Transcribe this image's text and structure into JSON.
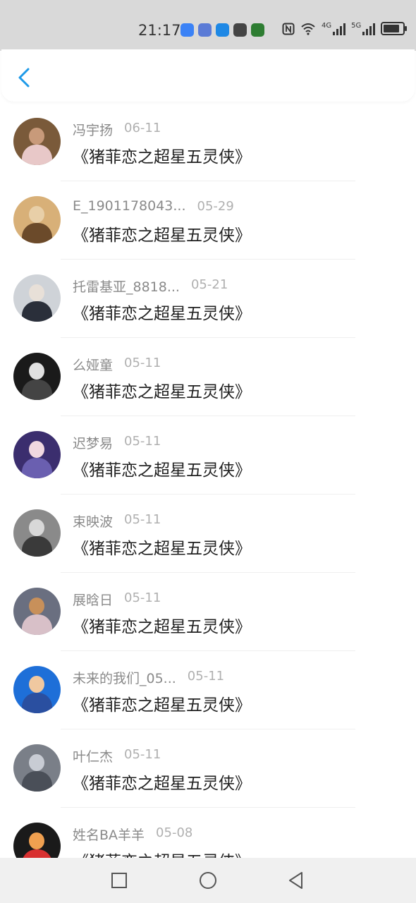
{
  "status_bar": {
    "time": "21:17",
    "net_4g": "4G",
    "net_5g": "5G",
    "battery_level": 0.85,
    "app_icons": [
      {
        "name": "browser-app-icon",
        "color": "#3b82f6"
      },
      {
        "name": "music-app-icon",
        "color": "#5b7bd6"
      },
      {
        "name": "navigation-app-icon",
        "color": "#1e88e5"
      },
      {
        "name": "phone-app-icon",
        "color": "#444444"
      },
      {
        "name": "video-app-icon",
        "color": "#2e7d32"
      }
    ]
  },
  "header": {
    "back_icon": "chevron-left-icon",
    "accent": "#1e9ae8"
  },
  "items": [
    {
      "name": "冯宇扬",
      "date": "06-11",
      "title": "《猪菲恋之超星五灵侠》",
      "avatar_bg": "#7a5a3a",
      "avatar_body": "#e8c8c8",
      "avatar_face": "#c89a7a"
    },
    {
      "name": "E_1901178043...",
      "date": "05-29",
      "title": "《猪菲恋之超星五灵侠》",
      "avatar_bg": "#d8b078",
      "avatar_body": "#6b4a2a",
      "avatar_face": "#e8cfa8"
    },
    {
      "name": "托雷基亚_8818...",
      "date": "05-21",
      "title": "《猪菲恋之超星五灵侠》",
      "avatar_bg": "#cfd3d8",
      "avatar_body": "#2a2f3a",
      "avatar_face": "#e8e0d8"
    },
    {
      "name": "么娅童",
      "date": "05-11",
      "title": "《猪菲恋之超星五灵侠》",
      "avatar_bg": "#1a1a1a",
      "avatar_body": "#444444",
      "avatar_face": "#e0e0e0"
    },
    {
      "name": "迟梦易",
      "date": "05-11",
      "title": "《猪菲恋之超星五灵侠》",
      "avatar_bg": "#3b2e6e",
      "avatar_body": "#6a5fb0",
      "avatar_face": "#f0d8e0"
    },
    {
      "name": "束映波",
      "date": "05-11",
      "title": "《猪菲恋之超星五灵侠》",
      "avatar_bg": "#8a8a8a",
      "avatar_body": "#3a3a3a",
      "avatar_face": "#d8d8d8"
    },
    {
      "name": "展晗日",
      "date": "05-11",
      "title": "《猪菲恋之超星五灵侠》",
      "avatar_bg": "#6a6f80",
      "avatar_body": "#d8c0c8",
      "avatar_face": "#c8905a"
    },
    {
      "name": "未来的我们_05...",
      "date": "05-11",
      "title": "《猪菲恋之超星五灵侠》",
      "avatar_bg": "#1e6fd8",
      "avatar_body": "#2a4fa0",
      "avatar_face": "#f0c8a0"
    },
    {
      "name": "叶仁杰",
      "date": "05-11",
      "title": "《猪菲恋之超星五灵侠》",
      "avatar_bg": "#7a7f88",
      "avatar_body": "#4a4f58",
      "avatar_face": "#c8ccd4"
    },
    {
      "name": "姓名BA羊羊",
      "date": "05-08",
      "title": "《猪菲恋之超星五灵侠》",
      "avatar_bg": "#1a1a1a",
      "avatar_body": "#d83030",
      "avatar_face": "#f0a050"
    }
  ],
  "nav_bar": {
    "recent_icon": "square-recent-apps-icon",
    "home_icon": "circle-home-icon",
    "back_icon": "triangle-back-icon"
  }
}
